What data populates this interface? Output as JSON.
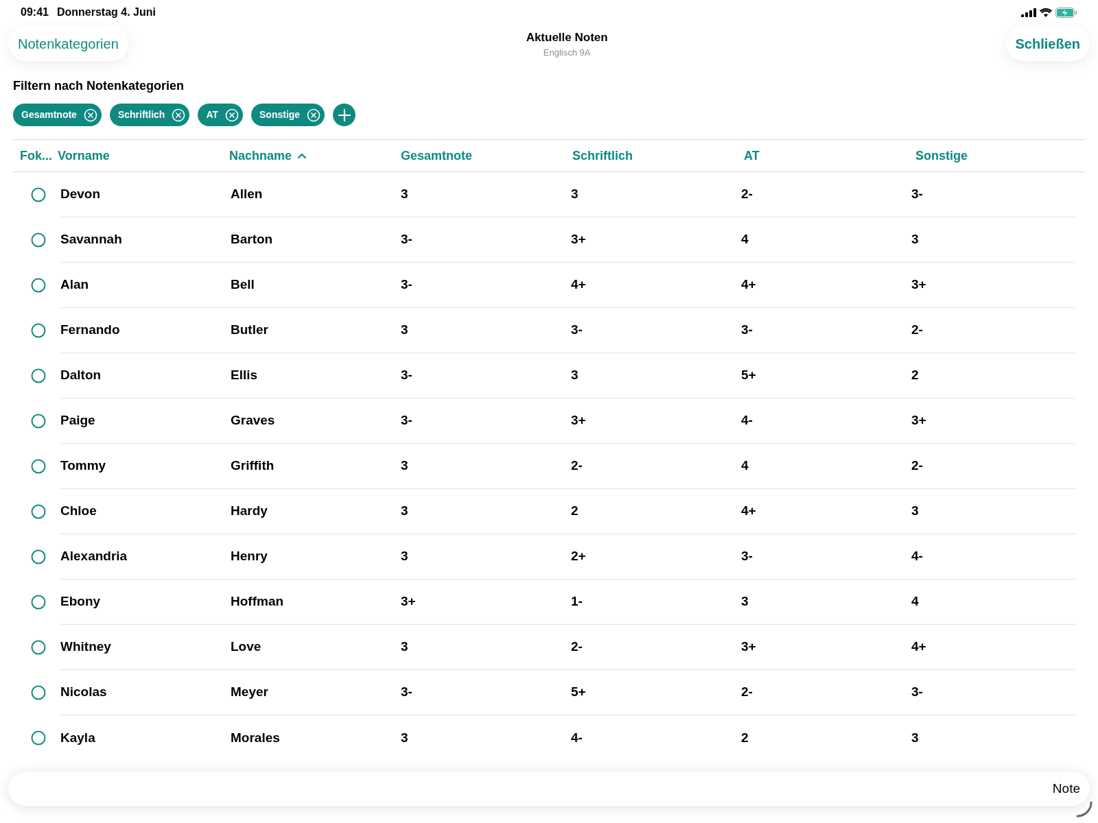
{
  "status_bar": {
    "time": "09:41",
    "date": "Donnerstag 4. Juni"
  },
  "nav": {
    "left_button": "Notenkategorien",
    "title": "Aktuelle Noten",
    "subtitle": "Englisch 9A",
    "right_button": "Schließen"
  },
  "filter": {
    "title": "Filtern nach Notenkategorien",
    "chips": [
      "Gesamtnote",
      "Schriftlich",
      "AT",
      "Sonstige"
    ]
  },
  "table": {
    "focus_column": "Fok...",
    "columns": [
      {
        "label": "Vorname",
        "sorted": false
      },
      {
        "label": "Nachname",
        "sorted": true
      },
      {
        "label": "Gesamtnote",
        "sorted": false
      },
      {
        "label": "Schriftlich",
        "sorted": false
      },
      {
        "label": "AT",
        "sorted": false
      },
      {
        "label": "Sonstige",
        "sorted": false
      }
    ],
    "rows": [
      {
        "focus": false,
        "cells": [
          "Devon",
          "Allen",
          "3",
          "3",
          "2-",
          "3-"
        ]
      },
      {
        "focus": false,
        "cells": [
          "Savannah",
          "Barton",
          "3-",
          "3+",
          "4",
          "3"
        ]
      },
      {
        "focus": false,
        "cells": [
          "Alan",
          "Bell",
          "3-",
          "4+",
          "4+",
          "3+"
        ]
      },
      {
        "focus": false,
        "cells": [
          "Fernando",
          "Butler",
          "3",
          "3-",
          "3-",
          "2-"
        ]
      },
      {
        "focus": false,
        "cells": [
          "Dalton",
          "Ellis",
          "3-",
          "3",
          "5+",
          "2"
        ]
      },
      {
        "focus": false,
        "cells": [
          "Paige",
          "Graves",
          "3-",
          "3+",
          "4-",
          "3+"
        ]
      },
      {
        "focus": false,
        "cells": [
          "Tommy",
          "Griffith",
          "3",
          "2-",
          "4",
          "2-"
        ]
      },
      {
        "focus": false,
        "cells": [
          "Chloe",
          "Hardy",
          "3",
          "2",
          "4+",
          "3"
        ]
      },
      {
        "focus": false,
        "cells": [
          "Alexandria",
          "Henry",
          "3",
          "2+",
          "3-",
          "4-"
        ]
      },
      {
        "focus": false,
        "cells": [
          "Ebony",
          "Hoffman",
          "3+",
          "1-",
          "3",
          "4"
        ]
      },
      {
        "focus": false,
        "cells": [
          "Whitney",
          "Love",
          "3",
          "2-",
          "3+",
          "4+"
        ]
      },
      {
        "focus": false,
        "cells": [
          "Nicolas",
          "Meyer",
          "3-",
          "5+",
          "2-",
          "3-"
        ]
      },
      {
        "focus": false,
        "cells": [
          "Kayla",
          "Morales",
          "3",
          "4-",
          "2",
          "3"
        ]
      }
    ]
  },
  "bottom_bar": {
    "placeholder": "Note"
  }
}
